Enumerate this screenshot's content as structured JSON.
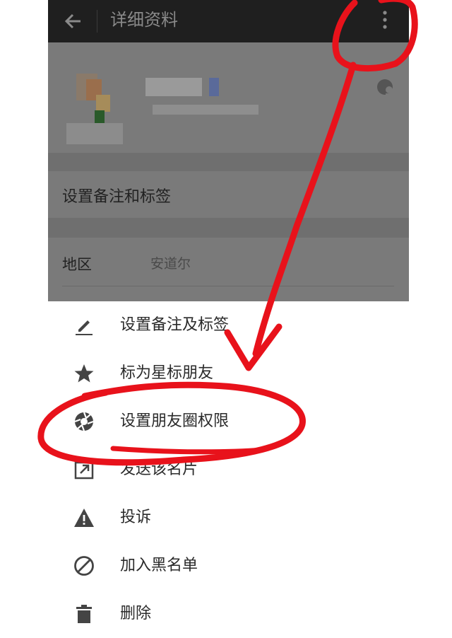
{
  "topbar": {
    "title": "详细资料"
  },
  "profile": {
    "remark_row": "设置备注和标签",
    "region_label": "地区",
    "region_value": "安道尔"
  },
  "menu": {
    "items": [
      {
        "label": "设置备注及标签",
        "icon": "pencil-icon"
      },
      {
        "label": "标为星标朋友",
        "icon": "star-icon"
      },
      {
        "label": "设置朋友圈权限",
        "icon": "aperture-icon"
      },
      {
        "label": "发送该名片",
        "icon": "share-icon"
      },
      {
        "label": "投诉",
        "icon": "warning-icon"
      },
      {
        "label": "加入黑名单",
        "icon": "block-icon"
      },
      {
        "label": "删除",
        "icon": "trash-icon"
      }
    ]
  },
  "colors": {
    "annotation": "#e8121b",
    "topbar": "#1f1f1f",
    "icon": "#444444"
  }
}
